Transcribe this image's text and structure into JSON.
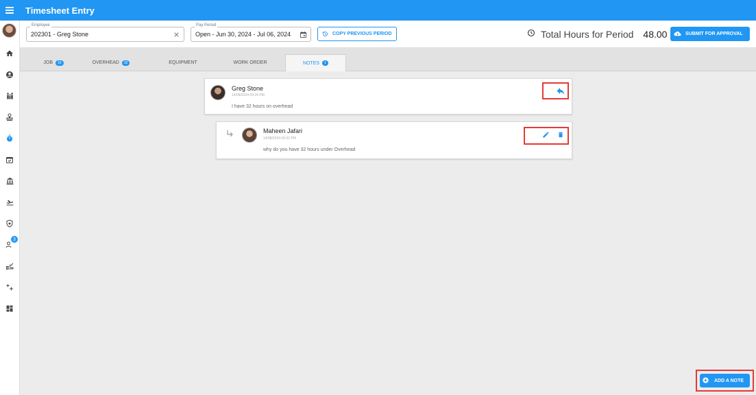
{
  "app": {
    "title": "Timesheet Entry"
  },
  "toolbar": {
    "employee": {
      "label": "Employee",
      "value": "202301 - Greg Stone"
    },
    "pay_period": {
      "label": "Pay Period",
      "value": "Open - Jun 30, 2024 - Jul 06, 2024"
    },
    "copy_label": "COPY PREVIOUS PERIOD",
    "total_label": "Total Hours for Period",
    "total_value": "48.00",
    "submit_label": "SUBMIT FOR APPROVAL"
  },
  "sidebar": {
    "items": [
      {
        "icon": "home-icon"
      },
      {
        "icon": "account-circle-icon"
      },
      {
        "icon": "people-icon"
      },
      {
        "icon": "stamp-icon"
      },
      {
        "icon": "stopwatch-icon"
      },
      {
        "icon": "calendar-check-icon"
      },
      {
        "icon": "bank-icon"
      },
      {
        "icon": "flight-takeoff-icon"
      },
      {
        "icon": "shield-icon"
      },
      {
        "icon": "group-notification-icon",
        "badge": "3"
      },
      {
        "icon": "hand-check-icon"
      },
      {
        "icon": "sparkle-icon"
      },
      {
        "icon": "dashboard-icon"
      }
    ]
  },
  "tabs": [
    {
      "label": "JOB",
      "badge": "16"
    },
    {
      "label": "OVERHEAD",
      "badge": "32"
    },
    {
      "label": "EQUIPMENT"
    },
    {
      "label": "WORK ORDER"
    },
    {
      "label": "NOTES",
      "badge": "1"
    }
  ],
  "notes": {
    "parent": {
      "author": "Greg Stone",
      "timestamp": "14/08/2024 09:29 PM",
      "text": "I have 32 hours on overhead"
    },
    "reply": {
      "author": "Maheen Jafari",
      "timestamp": "14/08/2024 09:32 PM",
      "text": "why do you have 32 hours under Overhead"
    }
  },
  "add_note_label": "ADD A NOTE",
  "colors": {
    "accent": "#2196f3",
    "highlight": "#e53935",
    "background": "#ececec"
  }
}
